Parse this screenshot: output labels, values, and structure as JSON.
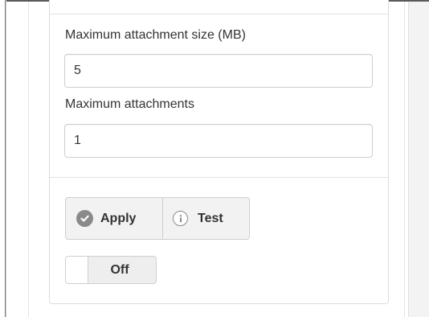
{
  "settings": {
    "max_attachment_size": {
      "label": "Maximum attachment size (MB)",
      "value": "5"
    },
    "max_attachments": {
      "label": "Maximum attachments",
      "value": "1"
    }
  },
  "actions": {
    "apply_label": "Apply",
    "apply_icon": "check-circle-icon",
    "test_label": "Test",
    "test_icon": "info-circle-icon"
  },
  "toggle": {
    "state_label": "Off",
    "on": false
  },
  "colors": {
    "icon_gray": "#8a8a8a",
    "button_bg": "#f2f2f2",
    "border": "#cfcfcf"
  }
}
